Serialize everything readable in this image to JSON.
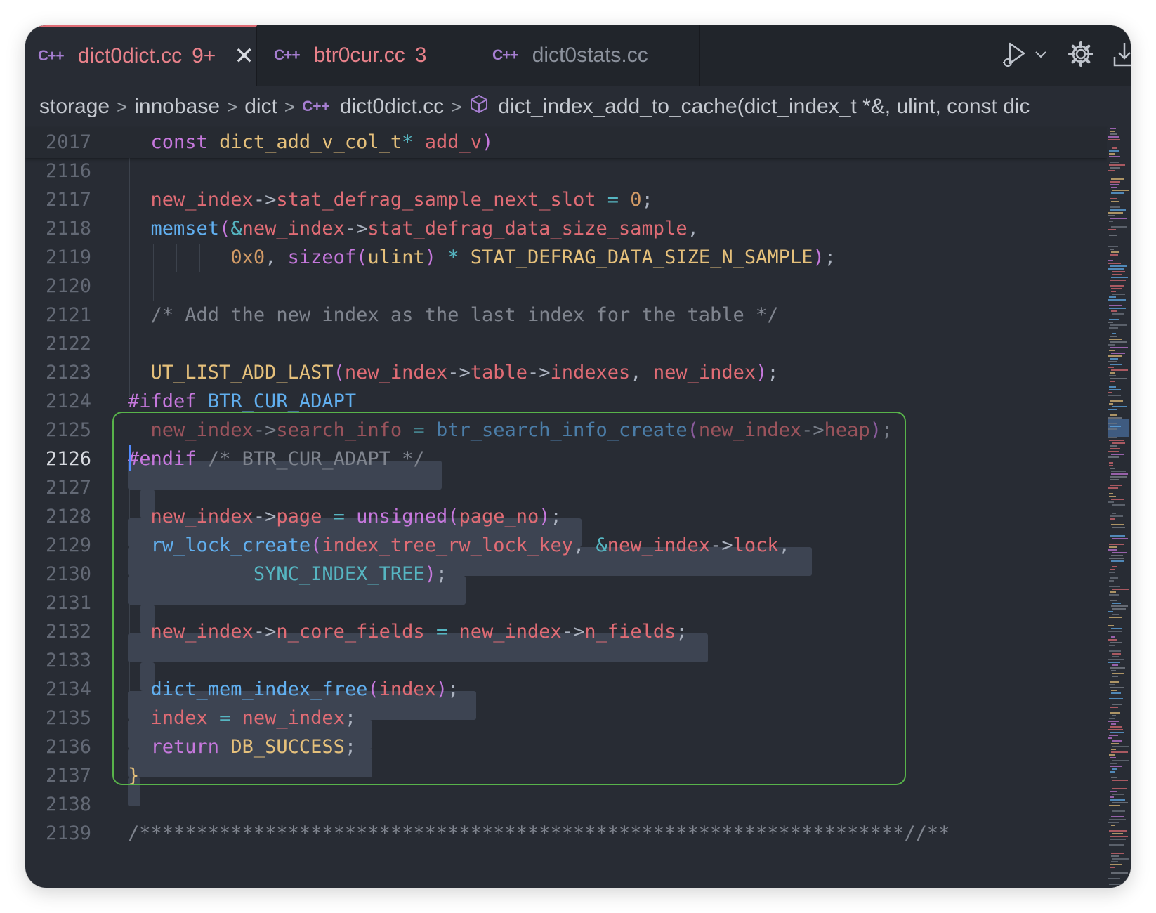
{
  "tabs": [
    {
      "icon": "C++",
      "label": "dict0dict.cc",
      "count": "9+",
      "active": true
    },
    {
      "icon": "C++",
      "label": "btr0cur.cc",
      "count": "3",
      "active": false
    },
    {
      "icon": "C++",
      "label": "dict0stats.cc",
      "count": "",
      "active": false
    }
  ],
  "tab_actions": [
    "run-debug-icon",
    "chevron-down-icon",
    "gear-icon",
    "download-icon"
  ],
  "breadcrumb": {
    "segments": [
      "storage",
      "innobase",
      "dict"
    ],
    "file_icon": "C++",
    "file": "dict0dict.cc",
    "symbol": "dict_index_add_to_cache(dict_index_t *&, ulint, const dic"
  },
  "sticky_line": {
    "number": "2017",
    "text": "  const dict_add_v_col_t* add_v)"
  },
  "lines": [
    {
      "n": "2116",
      "text": ""
    },
    {
      "n": "2117",
      "text": "  new_index->stat_defrag_sample_next_slot = 0;"
    },
    {
      "n": "2118",
      "text": "  memset(&new_index->stat_defrag_data_size_sample,"
    },
    {
      "n": "2119",
      "text": "         0x0, sizeof(ulint) * STAT_DEFRAG_DATA_SIZE_N_SAMPLE);"
    },
    {
      "n": "2120",
      "text": ""
    },
    {
      "n": "2121",
      "text": "  /* Add the new index as the last index for the table */"
    },
    {
      "n": "2122",
      "text": ""
    },
    {
      "n": "2123",
      "text": "  UT_LIST_ADD_LAST(new_index->table->indexes, new_index);"
    },
    {
      "n": "2124",
      "text": "#ifdef BTR_CUR_ADAPT"
    },
    {
      "n": "2125",
      "text": "  new_index->search_info = btr_search_info_create(new_index->heap);"
    },
    {
      "n": "2126",
      "text": "#endif /* BTR_CUR_ADAPT */"
    },
    {
      "n": "2127",
      "text": ""
    },
    {
      "n": "2128",
      "text": "  new_index->page = unsigned(page_no);"
    },
    {
      "n": "2129",
      "text": "  rw_lock_create(index_tree_rw_lock_key, &new_index->lock,"
    },
    {
      "n": "2130",
      "text": "           SYNC_INDEX_TREE);"
    },
    {
      "n": "2131",
      "text": ""
    },
    {
      "n": "2132",
      "text": "  new_index->n_core_fields = new_index->n_fields;"
    },
    {
      "n": "2133",
      "text": ""
    },
    {
      "n": "2134",
      "text": "  dict_mem_index_free(index);"
    },
    {
      "n": "2135",
      "text": "  index = new_index;"
    },
    {
      "n": "2136",
      "text": "  return DB_SUCCESS;"
    },
    {
      "n": "2137",
      "text": "}"
    },
    {
      "n": "2138",
      "text": ""
    },
    {
      "n": "2139",
      "text": "/*******************************************************************//**"
    }
  ],
  "current_line": "2126",
  "colors": {
    "editor_bg": "#282c34",
    "tabbar_bg": "#21252b",
    "selection": "#3d4452",
    "highlight_frame": "#58b34a",
    "accent": "#e06c75",
    "keyword": "#c678dd",
    "type": "#e5c07b",
    "variable": "#e06c75",
    "function": "#61afef",
    "number": "#d19a66",
    "comment": "#7f848e",
    "operator": "#56b6c2"
  }
}
